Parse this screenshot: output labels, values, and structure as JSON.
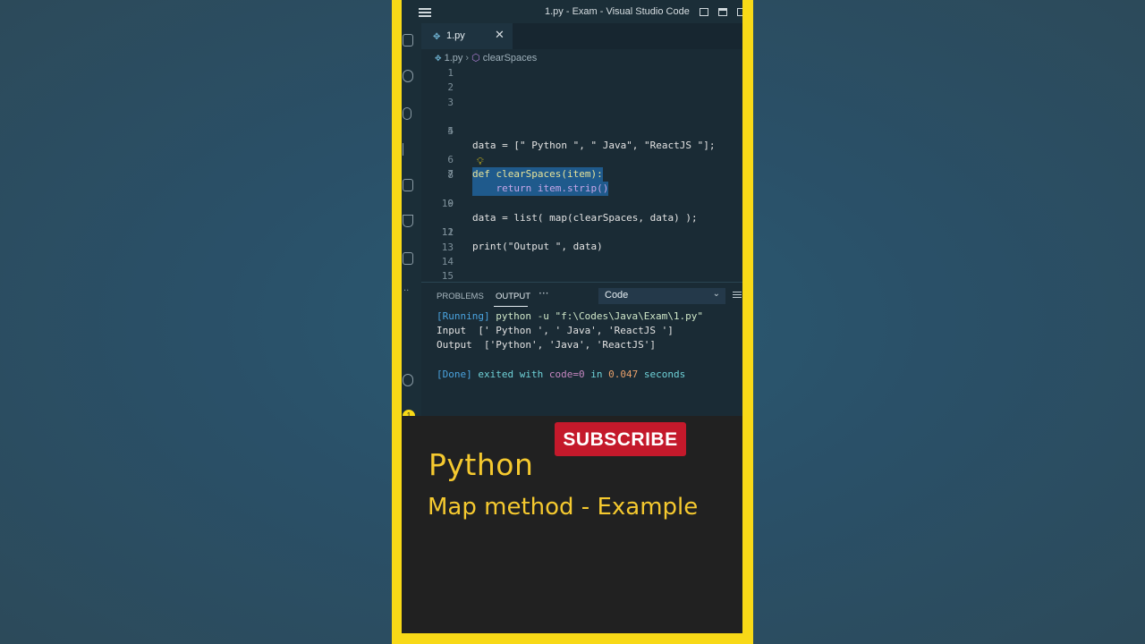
{
  "window": {
    "title": "1.py - Exam - Visual Studio Code"
  },
  "tab": {
    "label": "1.py",
    "close_glyph": "✕",
    "icon": "python-icon"
  },
  "breadcrumb": {
    "file": "1.py",
    "symbol": "clearSpaces"
  },
  "editor": {
    "line_numbers": [
      "1",
      "2",
      "3",
      "4",
      "5",
      "6",
      "7",
      "8",
      "9",
      "10",
      "11",
      "12",
      "13",
      "14",
      "15"
    ],
    "lines": {
      "l4": "data = [\" Python \", \" Java\", \"ReactJS \"];",
      "l6": "def clearSpaces(item):",
      "l7": "    return item.strip()",
      "l9": "data = list( map(clearSpaces, data) );",
      "l11": "print(\"Output \", data)"
    }
  },
  "panel": {
    "tabs": [
      "PROBLEMS",
      "OUTPUT"
    ],
    "active_tab": "OUTPUT",
    "more_glyph": "···",
    "dropdown_value": "Code",
    "output": {
      "running_tag": "[Running]",
      "running_cmd": "python -u \"f:\\Codes\\Java\\Exam\\1.py\"",
      "input_line": "Input  [' Python ', ' Java', 'ReactJS ']",
      "output_line": "Output  ['Python', 'Java', 'ReactJS']",
      "done_tag": "[Done]",
      "done_text1": "exited with",
      "done_code": "code=0",
      "done_text2": "in",
      "done_time": "0.047",
      "done_text3": "seconds"
    }
  },
  "activity_bar": {
    "badge_count": "1"
  },
  "overlay": {
    "subscribe_label": "SUBSCRIBE",
    "title": "Python",
    "subtitle": "Map method - Example"
  },
  "colors": {
    "frame": "#f8d917",
    "subscribe_bg": "#c4192b",
    "title_text": "#f5c92f",
    "selection": "#1f5a8c"
  }
}
